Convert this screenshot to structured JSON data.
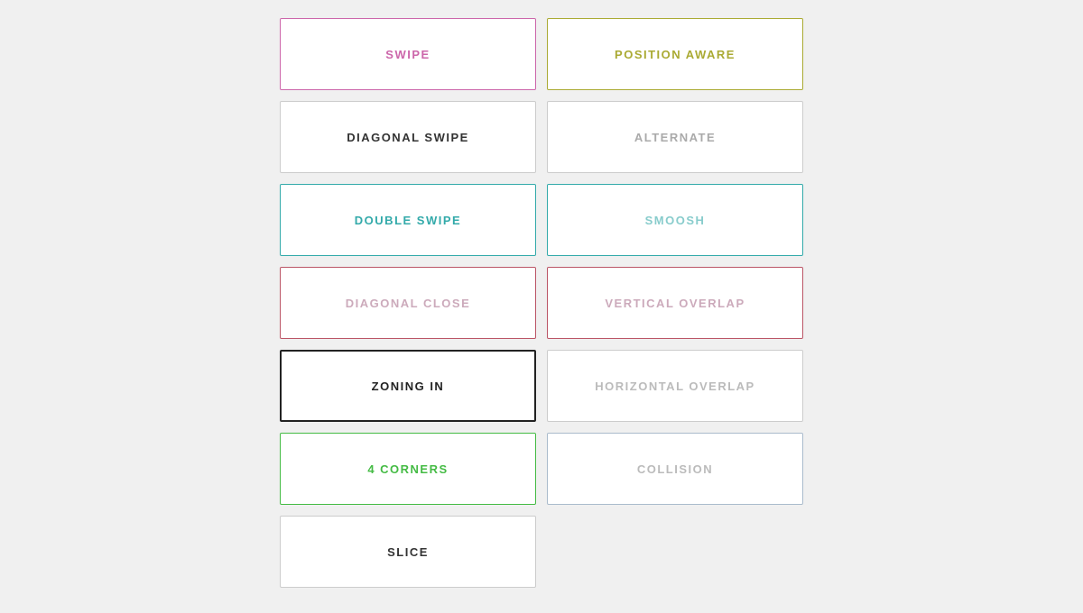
{
  "buttons": [
    {
      "id": "swipe",
      "label": "SWIPE",
      "border": "border-pink",
      "textColor": "text-pink",
      "col": 1
    },
    {
      "id": "position-aware",
      "label": "POSITION AWARE",
      "border": "border-olive",
      "textColor": "text-olive",
      "col": 2
    },
    {
      "id": "diagonal-swipe",
      "label": "DIAGONAL SWIPE",
      "border": "border-light",
      "textColor": "text-dark",
      "col": 1
    },
    {
      "id": "alternate",
      "label": "ALTERNATE",
      "border": "border-light",
      "textColor": "text-gray",
      "col": 2
    },
    {
      "id": "double-swipe",
      "label": "DOUBLE SWIPE",
      "border": "border-teal",
      "textColor": "text-teal",
      "col": 1
    },
    {
      "id": "smoosh",
      "label": "SMOOSH",
      "border": "border-teal",
      "textColor": "text-lteal",
      "col": 2
    },
    {
      "id": "diagonal-close",
      "label": "DIAGONAL CLOSE",
      "border": "border-rose",
      "textColor": "text-lrose",
      "col": 1
    },
    {
      "id": "vertical-overlap",
      "label": "VERTICAL OVERLAP",
      "border": "border-rose",
      "textColor": "text-lrose",
      "col": 2
    },
    {
      "id": "zoning-in",
      "label": "ZONING IN",
      "border": "border-black",
      "textColor": "text-black",
      "col": 1
    },
    {
      "id": "horizontal-overlap",
      "label": "HORIZONTAL OVERLAP",
      "border": "border-light",
      "textColor": "text-lgray",
      "col": 2
    },
    {
      "id": "4-corners",
      "label": "4 CORNERS",
      "border": "border-green",
      "textColor": "text-green",
      "col": 1
    },
    {
      "id": "collision",
      "label": "COLLISION",
      "border": "border-blue",
      "textColor": "text-lgray",
      "col": 2
    },
    {
      "id": "slice",
      "label": "SLICE",
      "border": "border-light",
      "textColor": "text-dark",
      "col": 1
    }
  ]
}
